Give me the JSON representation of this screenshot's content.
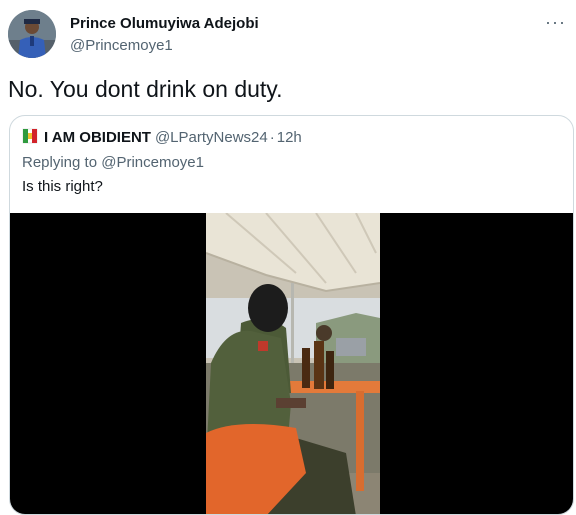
{
  "tweet": {
    "author_name": "Prince Olumuyiwa Adejobi",
    "author_handle": "@Princemoye1",
    "more_icon": "more-horizontal-icon",
    "text": "No. You dont drink on duty."
  },
  "quoted": {
    "flag_icon": "party-flag-icon",
    "author_name": "I AM OBIDIENT",
    "author_handle": "@LPartyNews24",
    "separator": "·",
    "time": "12h",
    "replying_label": "Replying to",
    "replying_to": "@Princemoye1",
    "text": "Is this right?",
    "media": "video-thumbnail"
  },
  "colors": {
    "text_primary": "#0f1419",
    "text_secondary": "#536471",
    "border": "#cfd9de",
    "video_bg": "#000000"
  }
}
